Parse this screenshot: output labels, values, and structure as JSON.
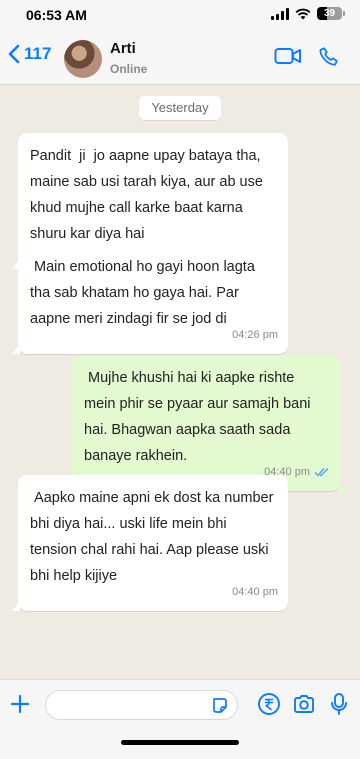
{
  "status_bar": {
    "time": "06:53 AM",
    "battery": "39",
    "battery_level": 0.39
  },
  "header": {
    "back_count": "117",
    "contact_name": "Arti",
    "contact_status": "Online"
  },
  "chat": {
    "date_separator": "Yesterday",
    "messages": [
      {
        "direction": "in",
        "text": "Pandit  ji  jo aapne upay bataya tha,\nmaine sab usi tarah kiya, aur ab use\nkhud mujhe call karke baat karna\nshuru kar diya hai",
        "time": "04:26 pm"
      },
      {
        "direction": "in",
        "text": " Main emotional ho gayi hoon lagta\ntha sab khatam ho gaya hai. Par\naapne meri zindagi fir se jod di",
        "time": "04:26 pm"
      },
      {
        "direction": "out",
        "text": " Mujhe khushi hai ki aapke rishte\nmein phir se pyaar aur samajh bani\nhai. Bhagwan aapka saath sada\nbanaye rakhein.",
        "time": "04:40 pm",
        "status": "read"
      },
      {
        "direction": "in",
        "text": " Aapko maine apni ek dost ka number\nbhi diya hai... uski life mein bhi\ntension chal rahi hai. Aap please uski\nbhi help kijiye",
        "time": "04:40 pm"
      }
    ]
  },
  "input": {
    "placeholder": ""
  },
  "icons": {
    "back": "chevron-left-icon",
    "video": "video-call-icon",
    "phone": "phone-icon",
    "plus": "plus-icon",
    "sticker": "sticker-icon",
    "rupee": "rupee-payment-icon",
    "camera": "camera-icon",
    "mic": "microphone-icon"
  },
  "colors": {
    "accent": "#0a7cff",
    "outgoing_bubble": "#e3f9cf",
    "incoming_bubble": "#ffffff",
    "background": "#efeae2"
  }
}
